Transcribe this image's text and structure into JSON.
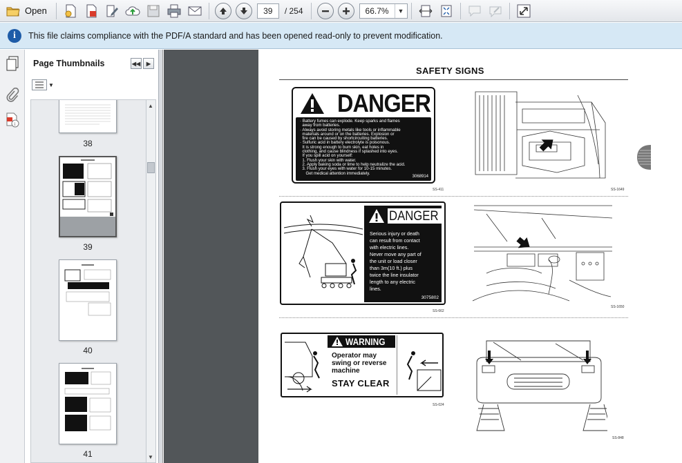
{
  "toolbar": {
    "open_label": "Open",
    "current_page": "39",
    "page_total": "/ 254",
    "zoom": "66.7%"
  },
  "infobar": {
    "message": "This file claims compliance with the PDF/A standard and has been opened read-only to prevent modification."
  },
  "thumbnails": {
    "header": "Page Thumbnails",
    "pages": [
      "38",
      "39",
      "40",
      "41"
    ]
  },
  "document": {
    "title": "SAFETY SIGNS",
    "sign1": {
      "heading": "DANGER",
      "lines": [
        "· Battery fumes can explode. Keep sparks and flames",
        "  away from batteries.",
        "· Always avoid storing metals like tools or inflammable",
        "  materials around or on the batteries. Explosion or",
        "  fire can be caused by shortcircuiting batteries.",
        "· Sulfuric acid in battery electrolyte is poisonous.",
        "  It is strong enough to burn skin, eat holes in",
        "  clothing, and cause blindness if splashed into eyes.",
        "  If you spill acid on yourself:",
        "  1. Flush your skin with water.",
        "  2. Apply baking soda or lime to help neutralize the acid.",
        "  3. Flush your eyes with water for 10-15 minutes.",
        "     Get medical attention immediately."
      ],
      "code": "3068914",
      "caption": "SS-411"
    },
    "fig1_caption": "SS-1649",
    "sign2": {
      "heading": "DANGER",
      "lines": [
        "Serious injury or death",
        "can result from contact",
        "with electric lines.",
        "Never move any part of",
        "the unit or load closer",
        "than 3m(10 ft.) plus",
        "twice the line insulator",
        "length to any electric",
        "lines."
      ],
      "code": "3075802",
      "caption": "SS-662"
    },
    "fig2_caption": "SS-1650",
    "sign3": {
      "heading": "WARNING",
      "lines": [
        "Operator may",
        "swing or reverse",
        "machine"
      ],
      "stay": "STAY CLEAR",
      "caption": "SS-024"
    },
    "fig3_caption": "SS-848"
  }
}
